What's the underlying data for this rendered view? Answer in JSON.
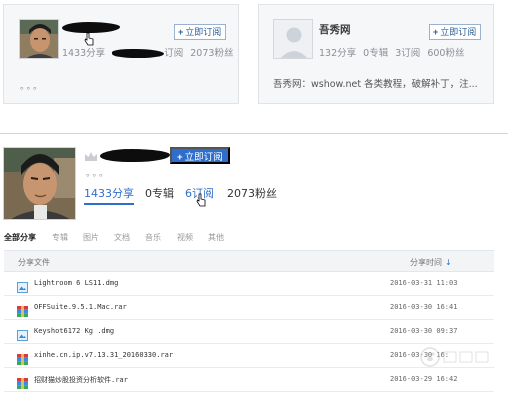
{
  "card_left": {
    "follow_label": "立即订阅",
    "stats": [
      "1433分享",
      "订阅",
      "2073粉丝"
    ],
    "dots": "。。。"
  },
  "card_right": {
    "name": "吾秀网",
    "follow_label": "立即订阅",
    "stats": [
      "132分享",
      "0专辑",
      "3订阅",
      "600粉丝"
    ],
    "description": "吾秀网：wshow.net 各类教程，破解补丁，注..."
  },
  "profile": {
    "follow_label": "立即订阅",
    "dots": "。。。",
    "stats": {
      "shares": "1433分享",
      "albums": "0专辑",
      "subscriptions": "6订阅",
      "fans": "2073粉丝"
    }
  },
  "tabs": [
    "全部分享",
    "专辑",
    "图片",
    "文档",
    "音乐",
    "视频",
    "其他"
  ],
  "table": {
    "col_file": "分享文件",
    "col_time": "分享时间",
    "sort_arrow": "↓",
    "rows": [
      {
        "name": "Lightroom 6 LS11.dmg",
        "time": "2016-03-31 11:03",
        "icon": "generic-file-icon"
      },
      {
        "name": "OFFSuite.9.5.1.Mac.rar",
        "time": "2016-03-30 16:41",
        "icon": "rar-archive-icon"
      },
      {
        "name": "Keyshot6172 Kg .dmg",
        "time": "2016-03-30 09:37",
        "icon": "generic-file-icon"
      },
      {
        "name": "xinhe.cn.ip.v7.13.31_20160330.rar",
        "time": "2016-03-30 16:",
        "icon": "rar-archive-icon"
      },
      {
        "name": "招财猫炒股投资分析软件.rar",
        "time": "2016-03-29 16:42",
        "icon": "rar-archive-icon"
      }
    ]
  },
  "colors": {
    "accent": "#2f6fcb",
    "card_bg": "#f6f7f9",
    "table_head_bg": "#f2f4f6"
  }
}
